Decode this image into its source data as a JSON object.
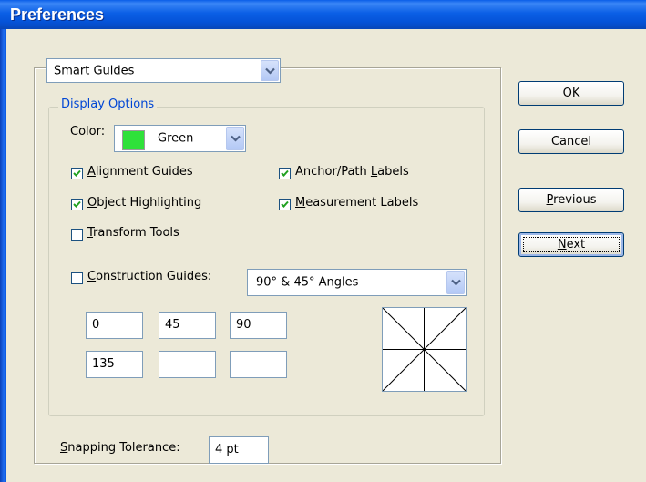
{
  "window": {
    "title": "Preferences"
  },
  "category": {
    "selected": "Smart Guides"
  },
  "display_options": {
    "title": "Display Options",
    "color_label": "Color:",
    "color_value": "Green",
    "color_swatch": "#2fe13a",
    "checkboxes": [
      {
        "label": "Alignment Guides",
        "mnemonic": "A",
        "rest": "lignment Guides",
        "checked": true
      },
      {
        "label": "Anchor/Path Labels",
        "pre": "Anchor/Path ",
        "mnemonic": "L",
        "rest": "abels",
        "checked": true
      },
      {
        "label": "Object Highlighting",
        "mnemonic": "O",
        "rest": "bject Highlighting",
        "checked": true
      },
      {
        "label": "Measurement Labels",
        "mnemonic": "M",
        "rest": "easurement Labels",
        "checked": true
      },
      {
        "label": "Transform Tools",
        "mnemonic": "T",
        "rest": "ransform Tools",
        "checked": false
      }
    ],
    "construction": {
      "mnemonic": "C",
      "rest": "onstruction Guides:",
      "checked": false,
      "angles_selected": "90° & 45° Angles",
      "angle_values": [
        "0",
        "45",
        "90",
        "135",
        "",
        ""
      ]
    }
  },
  "snapping": {
    "mnemonic": "S",
    "rest": "napping Tolerance:",
    "value": "4 pt"
  },
  "buttons": {
    "ok": "OK",
    "cancel": "Cancel",
    "previous_mnemonic": "P",
    "previous_rest": "revious",
    "next_mnemonic": "N",
    "next_rest": "ext"
  }
}
